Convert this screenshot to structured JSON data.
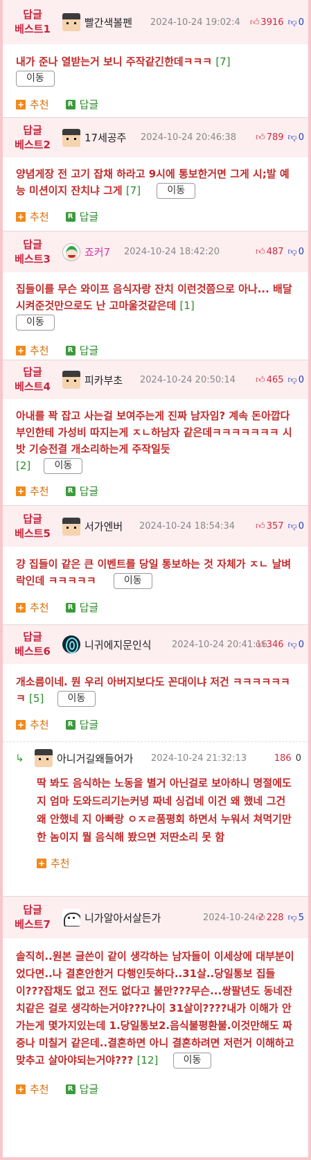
{
  "labels": {
    "recommend": "추천",
    "reply": "답글",
    "move": "이동",
    "rec_icon": "+",
    "reply_icon": "R"
  },
  "icons": {
    "thumb_up": "thumb-up-icon",
    "thumb_down": "thumb-down-icon",
    "reply_arrow": "reply-arrow-icon"
  },
  "colors": {
    "best_label": "#c6263e",
    "comment_text": "#c22a2a",
    "count": "#2a8a2a",
    "upvote": "#d0283a",
    "downvote": "#1a3fbf",
    "header_bg": "#fdeef0"
  },
  "posts": [
    {
      "best_line1": "답글",
      "best_line2": "베스트1",
      "nick": "빨간색볼펜",
      "date": "2024-10-24 19:02:4",
      "up": "3916",
      "down": "0",
      "text": "내가 준나 열받는거 보니 주작같긴한데ㅋㅋㅋ",
      "count": "[7]"
    },
    {
      "best_line1": "답글",
      "best_line2": "베스트2",
      "nick": "17세공주",
      "date": "2024-10-24 20:46:38",
      "up": "789",
      "down": "0",
      "text": "양념게장 전 고기 잡채 하라고 9시에 통보한거면 그게 시;발 예능 미션이지 잔치냐 그게",
      "count": "[7]"
    },
    {
      "best_line1": "답글",
      "best_line2": "베스트3",
      "nick": "죠커7",
      "date": "2024-10-24 18:42:20",
      "up": "487",
      "down": "0",
      "text": "집들이를 무슨 와이프 음식자랑 잔치 이런것쯤으로 아나... 배달 시켜준것만으로도 난 고마울것같은데",
      "count": "[1]"
    },
    {
      "best_line1": "답글",
      "best_line2": "베스트4",
      "nick": "피카부초",
      "date": "2024-10-24 20:50:14",
      "up": "465",
      "down": "0",
      "text": "아내를 꽉 잡고 사는걸 보여주는게 진짜 남자임? 계속 돈아깝다 부인한테 가성비 따지는게 ㅈㄴ하남자 같은데ㅋㅋㅋㅋㅋㅋㅋ 시밧 기승전결 개소리하는게 주작일듯",
      "count": "[2]"
    },
    {
      "best_line1": "답글",
      "best_line2": "베스트5",
      "nick": "서가엔버",
      "date": "2024-10-24 18:54:34",
      "up": "357",
      "down": "0",
      "text": "걍 집들이 같은 큰 이벤트를 당일 통보하는 것 자체가 ㅈㄴ 날벼락인데 ㅋㅋㅋㅋㅋ",
      "count": ""
    },
    {
      "best_line1": "답글",
      "best_line2": "베스트6",
      "nick": "니귀에지문인식",
      "date": "2024-10-24 20:41:16",
      "up": "346",
      "down": "0",
      "text": "개소름이네. 뭔 우리 아버지보다도 꼰대이냐 저건 ㅋㅋㅋㅋㅋㅋㅋ",
      "count": "[5]"
    },
    {
      "best_line1": "답글",
      "best_line2": "베스트7",
      "nick": "니가알아서살든가",
      "date": "2024-10-24 2",
      "up": "228",
      "down": "5",
      "text": "솔직히..원본 글쓴이 같이 생각하는 남자들이 이세상에 대부분이었다면..나 결혼안한거 다행인듯하다..31살..당일통보 집들이???잡채도 없고 전도 없다고 불만???무슨...쌍팔년도 동네잔치같은 걸로 생각하는거야???나이 31살이????내가 이해가 안가는게 몇가지있는데 1.당일통보2.음식불평환불.이것만해도 짜증나 미칠거 같은데..결혼하면 아니 결혼하려면 저런거 이해하고 맞추고 살아야되는거야???",
      "count": "[12]"
    }
  ],
  "reply": {
    "nick": "아니거길왜들어가",
    "date": "2024-10-24 21:32:13",
    "up": "186",
    "down": "0",
    "text": "딱 봐도 음식하는 노동을 별거 아닌걸로 보아하니 명절에도 지 엄마 도와드리기는커녕 짜네 싱겁네 이건 왜 했네 그건 왜 안했네 지 아빠랑 ㅇㅈㄹ품평회 하면서 누워서 쳐먹기만 한 놈이지 뭘 음식해 봤으면 저딴소리 못 함"
  }
}
